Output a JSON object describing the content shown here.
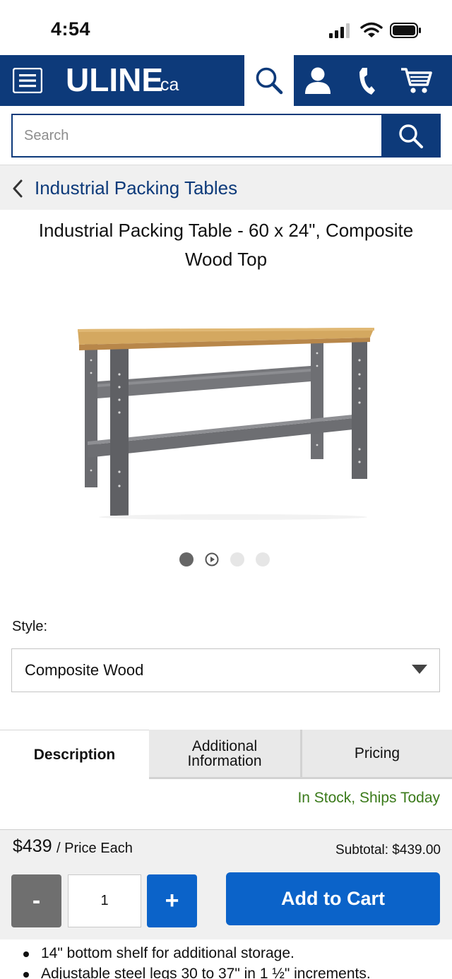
{
  "status_bar": {
    "time": "4:54"
  },
  "header": {
    "logo_main": "ULINE",
    "logo_suffix": ".ca"
  },
  "search": {
    "placeholder": "Search"
  },
  "breadcrumb": {
    "label": "Industrial Packing Tables"
  },
  "product": {
    "title": "Industrial Packing Table - 60 x 24\", Composite Wood Top",
    "image_count": 4,
    "active_image": 1
  },
  "style": {
    "label": "Style:",
    "selected": "Composite Wood"
  },
  "tabs": [
    {
      "label": "Description",
      "active": true
    },
    {
      "label": "Additional Information",
      "active": false
    },
    {
      "label": "Pricing",
      "active": false
    }
  ],
  "stock_status": "In Stock, Ships Today",
  "purchase": {
    "price": "$439",
    "price_unit": "/ Price Each",
    "subtotal": "Subtotal: $439.00",
    "minus": "-",
    "quantity": "1",
    "plus": "+",
    "add_to_cart": "Add to Cart"
  },
  "bullets": [
    "14\" bottom shelf for additional storage.",
    "Adjustable steel legs 30 to 37\" in 1 ½\" increments."
  ],
  "colors": {
    "brand_navy": "#0d3a7a",
    "action_blue": "#0b63c9",
    "stock_green": "#3a7a1a"
  }
}
